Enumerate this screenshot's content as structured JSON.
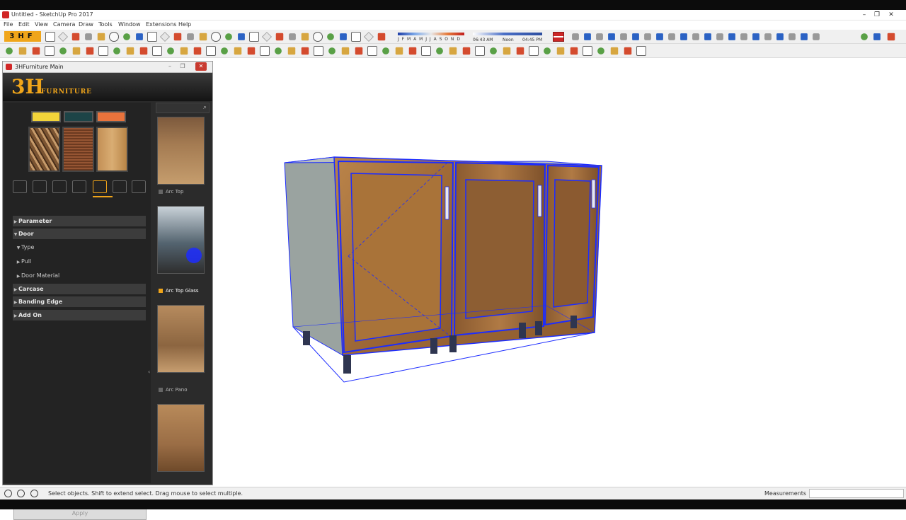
{
  "window": {
    "title": "Untitled - SketchUp Pro 2017",
    "minimize": "–",
    "restore": "❐",
    "close": "✕"
  },
  "menu": [
    "File",
    "Edit",
    "View",
    "Camera",
    "Draw",
    "Tools",
    "Window",
    "Extensions",
    "Help"
  ],
  "toolbar": {
    "logo": "3HF",
    "months": "J F M A M J J A S O N D",
    "time_start": "06:43 AM",
    "time_noon": "Noon",
    "time_end": "04:45 PM"
  },
  "panel": {
    "title": "3HFurniture Main",
    "banner_mark": "3H",
    "banner_text": "FURNITURE",
    "swatch_colors": [
      "#f2d43a",
      "#1d4447",
      "#e9733c"
    ],
    "sections": [
      {
        "label": "Parameter",
        "state": "collapsed",
        "level": "header"
      },
      {
        "label": "Door",
        "state": "expanded",
        "level": "header"
      },
      {
        "label": "Type",
        "state": "expanded",
        "level": "sub"
      },
      {
        "label": "Pull",
        "state": "collapsed",
        "level": "sub"
      },
      {
        "label": "Door Material",
        "state": "collapsed",
        "level": "sub"
      },
      {
        "label": "Carcase",
        "state": "collapsed",
        "level": "header"
      },
      {
        "label": "Banding Edge",
        "state": "collapsed",
        "level": "header"
      },
      {
        "label": "Add On",
        "state": "collapsed",
        "level": "header"
      }
    ],
    "apply_label": "Apply",
    "search_icon": "search-icon",
    "thumbnails": [
      {
        "label": "Arc Top",
        "selected": false
      },
      {
        "label": "Arc Top Glass",
        "selected": true
      },
      {
        "label": "Arc Pano",
        "selected": false
      },
      {
        "label": "",
        "selected": false
      }
    ]
  },
  "status": {
    "hint": "Select objects. Shift to extend select. Drag mouse to select multiple.",
    "measurements_label": "Measurements",
    "measurements_value": ""
  },
  "colors": {
    "accent": "#f0a51a",
    "selection": "#1c2cff",
    "panel_bg": "#2b2b2b"
  }
}
